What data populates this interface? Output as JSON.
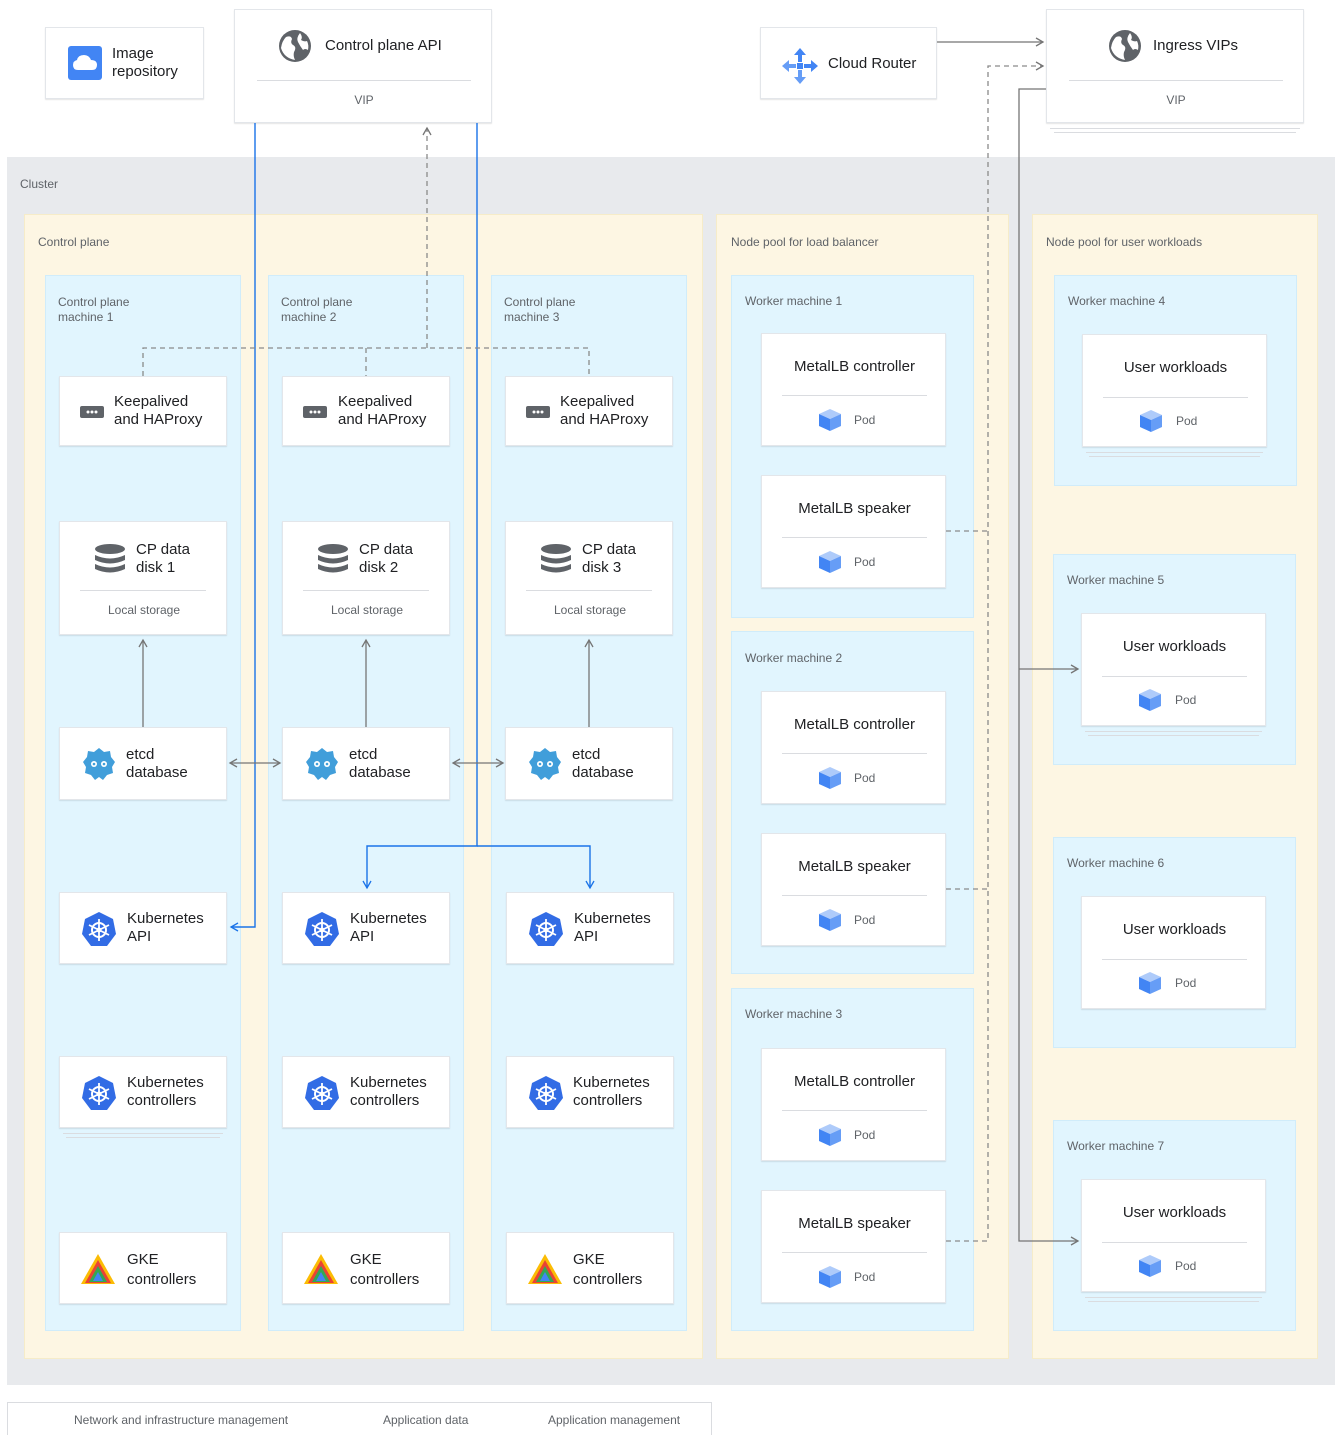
{
  "top": {
    "image_repository": "Image\nrepository",
    "control_plane_api": "Control plane API",
    "control_plane_vip": "VIP",
    "cloud_router": "Cloud Router",
    "ingress_vips": "Ingress VIPs",
    "ingress_vip": "VIP"
  },
  "cluster": {
    "label": "Cluster",
    "control_plane": {
      "label": "Control plane",
      "machines": [
        {
          "label": "Control plane\nmachine 1",
          "keepalived": "Keepalived\nand HAProxy",
          "disk": "CP data\ndisk 1",
          "storage": "Local storage",
          "etcd": "etcd\ndatabase",
          "k8s_api": "Kubernetes\nAPI",
          "k8s_ctrl": "Kubernetes\ncontrollers",
          "gke_ctrl": "GKE\ncontrollers"
        },
        {
          "label": "Control plane\nmachine 2",
          "keepalived": "Keepalived\nand HAProxy",
          "disk": "CP data\ndisk 2",
          "storage": "Local storage",
          "etcd": "etcd\ndatabase",
          "k8s_api": "Kubernetes\nAPI",
          "k8s_ctrl": "Kubernetes\ncontrollers",
          "gke_ctrl": "GKE\ncontrollers"
        },
        {
          "label": "Control plane\nmachine 3",
          "keepalived": "Keepalived\nand HAProxy",
          "disk": "CP data\ndisk 3",
          "storage": "Local storage",
          "etcd": "etcd\ndatabase",
          "k8s_api": "Kubernetes\nAPI",
          "k8s_ctrl": "Kubernetes\ncontrollers",
          "gke_ctrl": "GKE\ncontrollers"
        }
      ]
    },
    "lb_pool": {
      "label": "Node pool for load balancer",
      "machines": [
        {
          "label": "Worker machine 1",
          "controller": "MetalLB controller",
          "speaker": "MetalLB speaker",
          "pod": "Pod"
        },
        {
          "label": "Worker machine 2",
          "controller": "MetalLB controller",
          "speaker": "MetalLB speaker",
          "pod": "Pod"
        },
        {
          "label": "Worker machine 3",
          "controller": "MetalLB controller",
          "speaker": "MetalLB speaker",
          "pod": "Pod"
        }
      ]
    },
    "user_pool": {
      "label": "Node pool for user workloads",
      "machines": [
        {
          "label": "Worker machine 4",
          "workload": "User workloads",
          "pod": "Pod"
        },
        {
          "label": "Worker machine 5",
          "workload": "User workloads",
          "pod": "Pod"
        },
        {
          "label": "Worker machine 6",
          "workload": "User workloads",
          "pod": "Pod"
        },
        {
          "label": "Worker machine 7",
          "workload": "User workloads",
          "pod": "Pod"
        }
      ]
    }
  },
  "legend": {
    "dashed": "Network and infrastructure management",
    "solid": "Application data",
    "blue": "Application management"
  },
  "colors": {
    "cluster_bg": "#e8eaed",
    "zone_bg": "#fdf6e3",
    "machine_bg": "#e1f5fe",
    "google_blue": "#4285f4",
    "link_blue": "#1a73e8",
    "line_gray": "#757575",
    "text": "#202124"
  }
}
